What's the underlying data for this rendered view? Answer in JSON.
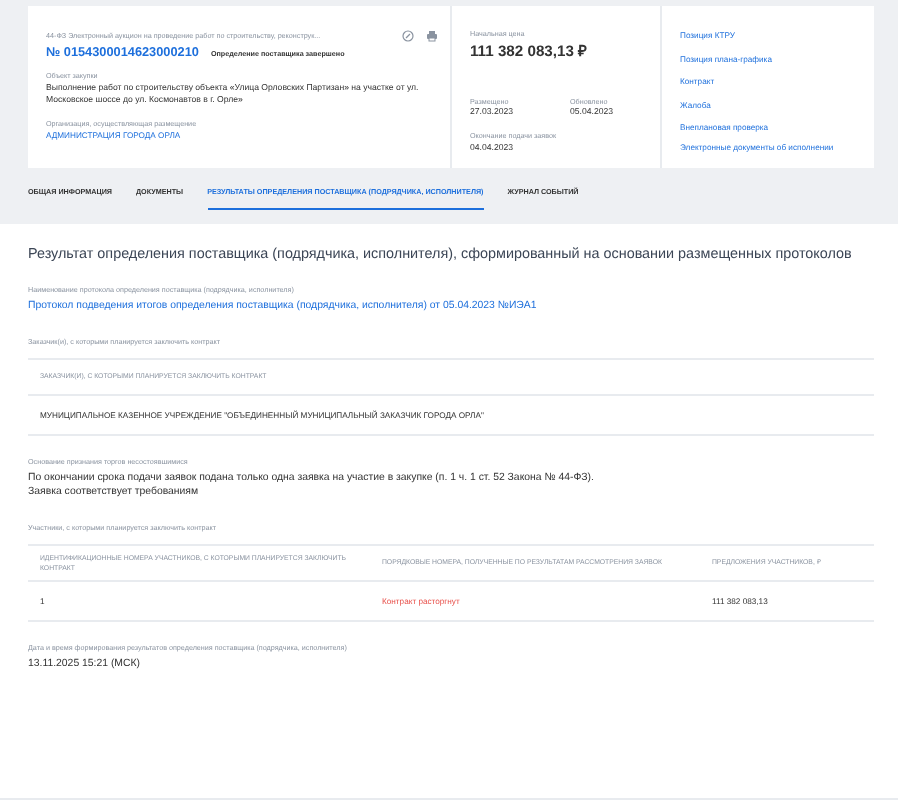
{
  "header": {
    "procedure": "44-ФЗ Электронный аукцион на проведение работ по строительству, реконструк...",
    "number": "№ 0154300014623000210",
    "status": "Определение поставщика завершено",
    "object_label": "Объект закупки",
    "object_text": "Выполнение работ по строительству объекта «Улица Орловских Партизан» на участке от ул. Московское шоссе до ул. Космонавтов в г. Орле»",
    "org_label": "Организация, осуществляющая размещение",
    "org_name": "АДМИНИСТРАЦИЯ ГОРОДА ОРЛА",
    "price_label": "Начальная цена",
    "price": "111 382 083,13 ₽",
    "dates": [
      {
        "label": "Размещено",
        "value": "27.03.2023"
      },
      {
        "label": "Обновлено",
        "value": "05.04.2023"
      },
      {
        "label": "Окончание подачи заявок",
        "value": "04.04.2023"
      }
    ],
    "links": [
      "Позиция КТРУ",
      "Позиция плана-графика",
      "Контракт",
      "Жалоба",
      "Внеплановая проверка",
      "Электронные документы об исполнении"
    ]
  },
  "tabs": [
    {
      "label": "ОБЩАЯ ИНФОРМАЦИЯ",
      "selected": false
    },
    {
      "label": "ДОКУМЕНТЫ",
      "selected": false
    },
    {
      "label": "РЕЗУЛЬТАТЫ ОПРЕДЕЛЕНИЯ ПОСТАВЩИКА (ПОДРЯДЧИКА, ИСПОЛНИТЕЛЯ)",
      "selected": true
    },
    {
      "label": "ЖУРНАЛ СОБЫТИЙ",
      "selected": false
    }
  ],
  "result": {
    "title": "Результат определения поставщика (подрядчика, исполнителя), сформированный на основании размещенных протоколов",
    "sections": [
      {
        "kind": "link",
        "label": "Наименование протокола определения поставщика (подрядчика, исполнителя)",
        "value": "Протокол подведения итогов определения поставщика (подрядчика, исполнителя) от 05.04.2023 №ИЭА1"
      },
      {
        "kind": "table",
        "label": "Заказчик(и), с которыми планируется заключить контракт",
        "columns": [
          "ЗАКАЗЧИК(И), С КОТОРЫМИ ПЛАНИРУЕТСЯ ЗАКЛЮЧИТЬ КОНТРАКТ"
        ],
        "rows": [
          {
            "cells": [
              {
                "text": "МУНИЦИПАЛЬНОЕ КАЗЕННОЕ УЧРЕЖДЕНИЕ \"ОБЪЕДИНЕННЫЙ МУНИЦИПАЛЬНЫЙ ЗАКАЗЧИК ГОРОДА ОРЛА\"",
                "kind": "plain"
              }
            ]
          }
        ]
      },
      {
        "kind": "text",
        "label": "Основание признания торгов несостоявшимися",
        "value": "По окончании срока подачи заявок подана только одна заявка на участие в закупке (п. 1 ч. 1 ст. 52 Закона № 44-ФЗ). Заявка соответствует требованиям"
      },
      {
        "kind": "table",
        "label": "Участники, с которыми планируется заключить контракт",
        "columns": [
          "ИДЕНТИФИКАЦИОННЫЕ НОМЕРА УЧАСТНИКОВ, С КОТОРЫМИ ПЛАНИРУЕТСЯ ЗАКЛЮЧИТЬ КОНТРАКТ",
          "ПОРЯДКОВЫЕ НОМЕРА, ПОЛУЧЕННЫЕ ПО РЕЗУЛЬТАТАМ РАССМОТРЕНИЯ ЗАЯВОК",
          "ПРЕДЛОЖЕНИЯ УЧАСТНИКОВ, ₽"
        ],
        "rows": [
          {
            "cells": [
              {
                "text": "1",
                "kind": "plain"
              },
              {
                "text": "Контракт расторгнут",
                "kind": "alert"
              },
              {
                "text": "111 382 083,13",
                "kind": "plain"
              }
            ]
          }
        ]
      },
      {
        "kind": "text",
        "label": "Дата и время формирования результатов определения поставщика (подрядчика, исполнителя)",
        "value": "13.11.2025 15:21 (МСК)"
      }
    ]
  }
}
